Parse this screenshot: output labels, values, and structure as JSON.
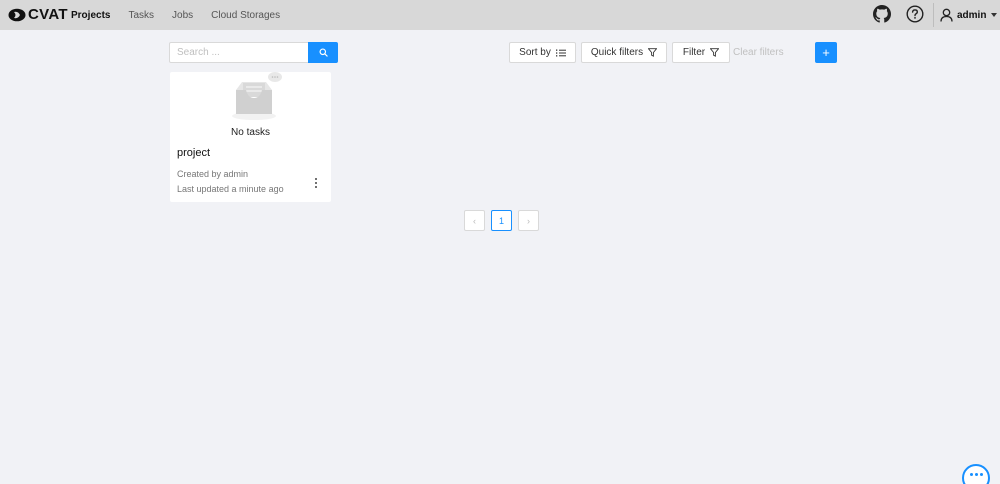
{
  "header": {
    "logo_text": "CVAT",
    "nav": [
      {
        "label": "Projects",
        "active": true
      },
      {
        "label": "Tasks",
        "active": false
      },
      {
        "label": "Jobs",
        "active": false
      },
      {
        "label": "Cloud Storages",
        "active": false
      }
    ],
    "icons": [
      "github-icon",
      "help-icon",
      "user-icon"
    ],
    "user_name": "admin"
  },
  "toolbar": {
    "search_placeholder": "Search ...",
    "sort_label": "Sort by",
    "quick_filters_label": "Quick filters",
    "filter_label": "Filter",
    "clear_filters_label": "Clear filters",
    "add_label": "+",
    "accent_color": "#1890ff"
  },
  "projects": [
    {
      "preview_text": "No tasks",
      "name": "project",
      "created_by": "Created by admin",
      "last_updated": "Last updated a minute ago"
    }
  ],
  "pagination": {
    "prev": "‹",
    "current_page": "1",
    "next": "›"
  }
}
